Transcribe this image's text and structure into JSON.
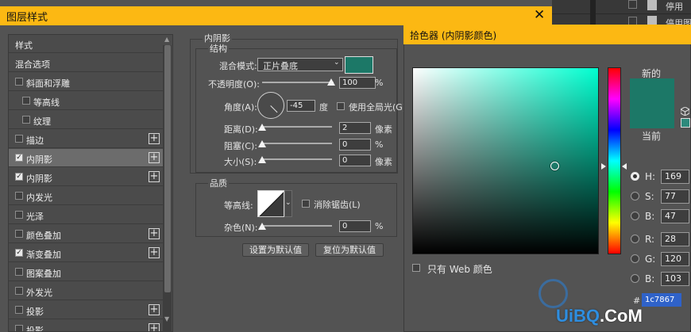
{
  "dialog": {
    "title": "图层样式",
    "close_glyph": "✕",
    "style_list": [
      {
        "label": "样式",
        "checkbox": false,
        "indent": 0,
        "plus": false
      },
      {
        "label": "混合选项",
        "checkbox": false,
        "indent": 0,
        "plus": false
      },
      {
        "label": "斜面和浮雕",
        "checkbox": true,
        "checked": false,
        "indent": 0,
        "plus": false
      },
      {
        "label": "等高线",
        "checkbox": true,
        "checked": false,
        "indent": 1,
        "plus": false
      },
      {
        "label": "纹理",
        "checkbox": true,
        "checked": false,
        "indent": 1,
        "plus": false
      },
      {
        "label": "描边",
        "checkbox": true,
        "checked": false,
        "indent": 0,
        "plus": true
      },
      {
        "label": "内阴影",
        "checkbox": true,
        "checked": true,
        "indent": 0,
        "plus": true,
        "selected": true
      },
      {
        "label": "内阴影",
        "checkbox": true,
        "checked": true,
        "indent": 0,
        "plus": true
      },
      {
        "label": "内发光",
        "checkbox": true,
        "checked": false,
        "indent": 0,
        "plus": false
      },
      {
        "label": "光泽",
        "checkbox": true,
        "checked": false,
        "indent": 0,
        "plus": false
      },
      {
        "label": "颜色叠加",
        "checkbox": true,
        "checked": false,
        "indent": 0,
        "plus": true
      },
      {
        "label": "渐变叠加",
        "checkbox": true,
        "checked": true,
        "indent": 0,
        "plus": true
      },
      {
        "label": "图案叠加",
        "checkbox": true,
        "checked": false,
        "indent": 0,
        "plus": false
      },
      {
        "label": "外发光",
        "checkbox": true,
        "checked": false,
        "indent": 0,
        "plus": false
      },
      {
        "label": "投影",
        "checkbox": true,
        "checked": false,
        "indent": 0,
        "plus": true
      },
      {
        "label": "投影",
        "checkbox": true,
        "checked": false,
        "indent": 0,
        "plus": true
      }
    ],
    "inner_shadow": {
      "section_title": "内阴影",
      "structure_title": "结构",
      "blend_mode_label": "混合模式:",
      "blend_mode_value": "正片叠底",
      "opacity_label": "不透明度(O):",
      "opacity_value": "100",
      "opacity_unit": "%",
      "angle_label": "角度(A):",
      "angle_value": "-45",
      "angle_unit": "度",
      "global_light_label": "使用全局光(G)",
      "global_light_checked": false,
      "distance_label": "距离(D):",
      "distance_value": "2",
      "distance_unit": "像素",
      "choke_label": "阻塞(C):",
      "choke_value": "0",
      "choke_unit": "%",
      "size_label": "大小(S):",
      "size_value": "0",
      "size_unit": "像素",
      "quality_title": "品质",
      "contour_label": "等高线:",
      "anti_alias_label": "消除锯齿(L)",
      "anti_alias_checked": false,
      "noise_label": "杂色(N):",
      "noise_value": "0",
      "noise_unit": "%",
      "make_default_label": "设置为默认值",
      "reset_default_label": "复位为默认值"
    }
  },
  "picker": {
    "title": "拾色器 (内阴影颜色)",
    "new_label": "新的",
    "current_label": "当前",
    "web_only_label": "只有 Web 颜色",
    "web_only_checked": false,
    "hash_label": "#"
  },
  "color": {
    "hsb": {
      "h": 169,
      "s": 77,
      "b": 47
    },
    "hsb_labels": {
      "h": "H:",
      "s": "S:",
      "b": "B:"
    },
    "rgb_labels": {
      "r": "R:",
      "g": "G:",
      "b": "B:"
    },
    "selected_mode": "h"
  },
  "background_panel": {
    "rows": [
      "停用",
      "停用图"
    ]
  },
  "watermark": {
    "text_blue": "UiBQ",
    "text_white": ".CoM"
  }
}
